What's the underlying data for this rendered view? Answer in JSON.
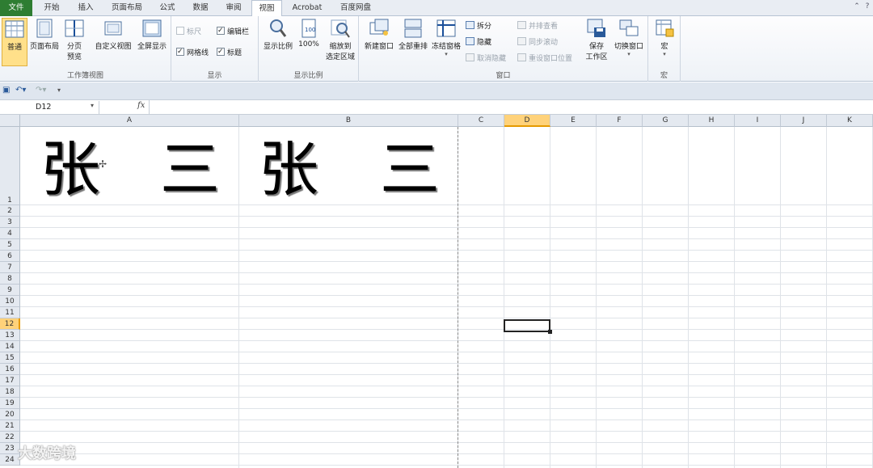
{
  "tabs": [
    "文件",
    "开始",
    "插入",
    "页面布局",
    "公式",
    "数据",
    "审阅",
    "视图",
    "Acrobat",
    "百度网盘"
  ],
  "ribbon": {
    "workbook_views": {
      "label": "工作簿视图",
      "normal": "普通",
      "page_layout": "页面布局",
      "page_break_1": "分页",
      "page_break_2": "预览",
      "custom_views": "自定义视图",
      "full_screen": "全屏显示"
    },
    "show": {
      "label": "显示",
      "ruler": "标尺",
      "formula_bar": "编辑栏",
      "gridlines": "网格线",
      "headings": "标题"
    },
    "zoom": {
      "label": "显示比例",
      "zoom": "显示比例",
      "hundred": "100%",
      "zoom_sel_1": "缩放到",
      "zoom_sel_2": "选定区域"
    },
    "window": {
      "label": "窗口",
      "new_window": "新建窗口",
      "arrange_all": "全部重排",
      "freeze_panes": "冻结窗格",
      "split": "拆分",
      "hide": "隐藏",
      "unhide": "取消隐藏",
      "side_by_side": "并排查看",
      "sync_scroll": "同步滚动",
      "reset_pos": "重设窗口位置",
      "save_ws_1": "保存",
      "save_ws_2": "工作区",
      "switch_windows": "切换窗口"
    },
    "macros": {
      "label": "宏",
      "macros": "宏"
    }
  },
  "formula_bar": {
    "name_box": "D12",
    "fx": "fx",
    "content": ""
  },
  "columns": [
    "A",
    "B",
    "C",
    "D",
    "E",
    "F",
    "G",
    "H",
    "I",
    "J",
    "K"
  ],
  "rows": [
    "1",
    "2",
    "3",
    "4",
    "5",
    "6",
    "7",
    "8",
    "9",
    "10",
    "11",
    "12",
    "13",
    "14",
    "15",
    "16",
    "17",
    "18",
    "19",
    "20",
    "21",
    "22",
    "23",
    "24"
  ],
  "selected_cell": "D12",
  "cells": {
    "A1_left": "张",
    "A1_right": "三",
    "B1_left": "张",
    "B1_right": "三"
  },
  "watermark": "大数跨境"
}
